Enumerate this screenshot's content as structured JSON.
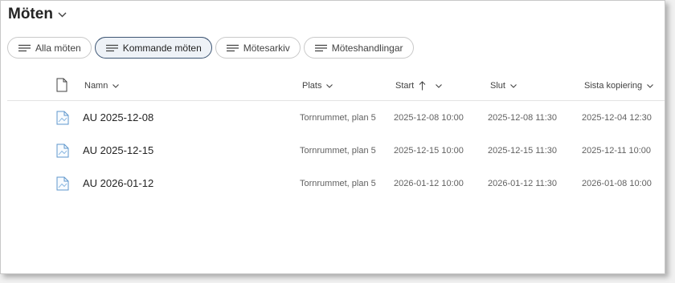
{
  "page": {
    "title": "Möten"
  },
  "views": [
    {
      "label": "Alla möten",
      "active": false
    },
    {
      "label": "Kommande möten",
      "active": true
    },
    {
      "label": "Mötesarkiv",
      "active": false
    },
    {
      "label": "Möteshandlingar",
      "active": false
    }
  ],
  "columns": {
    "name": "Namn",
    "location": "Plats",
    "start": "Start",
    "end": "Slut",
    "last_copy": "Sista kopiering"
  },
  "rows": [
    {
      "name": "AU 2025-12-08",
      "location": "Tornrummet, plan 5",
      "start": "2025-12-08 10:00",
      "end": "2025-12-08 11:30",
      "last_copy": "2025-12-04 12:30"
    },
    {
      "name": "AU 2025-12-15",
      "location": "Tornrummet, plan 5",
      "start": "2025-12-15 10:00",
      "end": "2025-12-15 11:30",
      "last_copy": "2025-12-11 10:00"
    },
    {
      "name": "AU 2026-01-12",
      "location": "Tornrummet, plan 5",
      "start": "2026-01-12 10:00",
      "end": "2026-01-12 11:30",
      "last_copy": "2026-01-08 10:00"
    }
  ],
  "sort": {
    "column": "start",
    "direction": "ascending"
  },
  "icons": {
    "title": "chevron-down-icon",
    "views": "view-lines-icon",
    "file_type": "document-icon",
    "row_file": "document-icon",
    "sort": "arrow-up-icon"
  }
}
